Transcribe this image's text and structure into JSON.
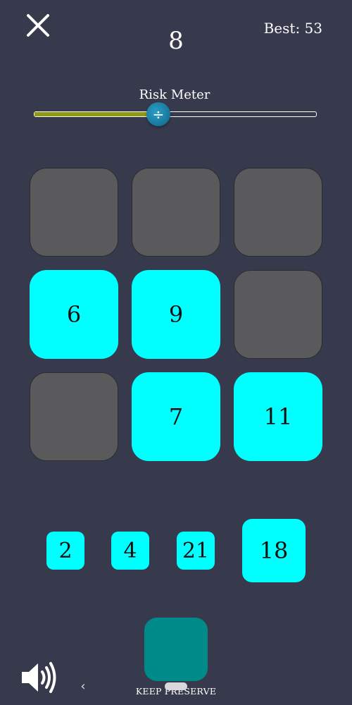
{
  "header": {
    "score": "8",
    "best_label": "Best: 53"
  },
  "risk_meter": {
    "label": "Risk Meter",
    "level": 0.44,
    "thumb_symbol": "÷",
    "fill_color": "#8f9912"
  },
  "board": {
    "cells": [
      {
        "value": "",
        "filled": false
      },
      {
        "value": "",
        "filled": false
      },
      {
        "value": "",
        "filled": false
      },
      {
        "value": "6",
        "filled": true
      },
      {
        "value": "9",
        "filled": true
      },
      {
        "value": "",
        "filled": false
      },
      {
        "value": "",
        "filled": false
      },
      {
        "value": "7",
        "filled": true
      },
      {
        "value": "11",
        "filled": true
      }
    ]
  },
  "hand": {
    "tiles": [
      {
        "value": "2"
      },
      {
        "value": "4"
      },
      {
        "value": "21"
      },
      {
        "value": "18"
      }
    ]
  },
  "footer": {
    "keep_label": "KEEP PRESERVE"
  },
  "icons": {
    "close": "close-icon",
    "sound": "speaker-volume-icon",
    "back": "chevron-left-icon"
  },
  "colors": {
    "background": "#373a4d",
    "tile_filled": "#00ffff",
    "tile_empty": "#5a5a5c",
    "keep_button": "#008b8b",
    "thumb": "#1c7ea5"
  }
}
